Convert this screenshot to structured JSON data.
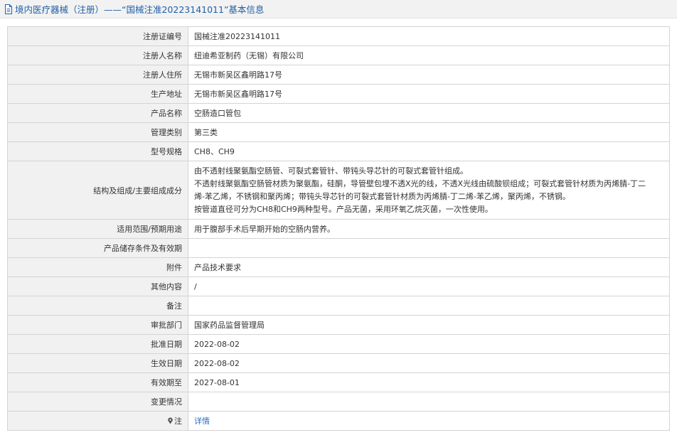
{
  "header": {
    "title": "境内医疗器械（注册）——“国械注准20223141011”基本信息"
  },
  "rows": [
    {
      "label": "注册证编号",
      "value": "国械注准20223141011"
    },
    {
      "label": "注册人名称",
      "value": "纽迪希亚制药（无锡）有限公司"
    },
    {
      "label": "注册人住所",
      "value": "无锡市新吴区鑫明路17号"
    },
    {
      "label": "生产地址",
      "value": "无锡市新吴区鑫明路17号"
    },
    {
      "label": "产品名称",
      "value": "空肠造口管包"
    },
    {
      "label": "管理类别",
      "value": "第三类"
    },
    {
      "label": "型号规格",
      "value": "CH8、CH9"
    },
    {
      "label": "结构及组成/主要组成成分",
      "lines": [
        "由不透射线聚氨酯空肠管、可裂式套管针、带钝头导芯针的可裂式套管针组成。",
        "不透射线聚氨酯空肠管材质为聚氨酯，硅酮，导管壁包埋不透X光的线，不透X光线由硫酸钡组成；可裂式套管针材质为丙烯腈-丁二",
        "烯-苯乙烯，不锈钢和聚丙烯；带钝头导芯针的可裂式套管针材质为丙烯腈-丁二烯-苯乙烯，聚丙烯，不锈钢。",
        "按管道直径可分为CH8和CH9两种型号。产品无菌，采用环氧乙烷灭菌，一次性使用。"
      ]
    },
    {
      "label": "适用范围/预期用途",
      "value": "用于腹部手术后早期开始的空肠内营养。"
    },
    {
      "label": "产品储存条件及有效期",
      "value": ""
    },
    {
      "label": "附件",
      "value": "产品技术要求"
    },
    {
      "label": "其他内容",
      "value": "/"
    },
    {
      "label": "备注",
      "value": ""
    },
    {
      "label": "审批部门",
      "value": "国家药品监督管理局"
    },
    {
      "label": "批准日期",
      "value": "2022-08-02"
    },
    {
      "label": "生效日期",
      "value": "2022-08-02"
    },
    {
      "label": "有效期至",
      "value": "2027-08-01"
    },
    {
      "label": "变更情况",
      "value": ""
    }
  ],
  "note_row": {
    "label": "注",
    "link_text": "详情"
  },
  "icons": {
    "title": "document-icon",
    "note": "pin-icon"
  },
  "colors": {
    "title_text": "#1f5fa8",
    "label_bg": "#f1f1f1",
    "border": "#d4d4d4",
    "link": "#2a6ebb"
  }
}
